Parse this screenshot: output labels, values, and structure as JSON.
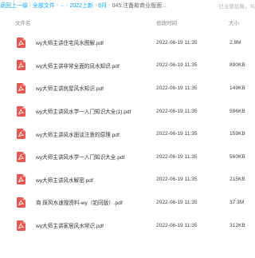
{
  "breadcrumb": {
    "back": "返回上一级",
    "items": [
      "全部文件",
      "...",
      "2022上新",
      "6月",
      "045.注备款商业版面..."
    ],
    "loaded_status": "已全部加载，共"
  },
  "columns": {
    "name": "文件名",
    "time": "修改时间",
    "size": "大小"
  },
  "files": [
    {
      "name": "wy大师主讲住宅风水图解.pdf",
      "time": "2022-06-19 11:35",
      "size": "2.8M"
    },
    {
      "name": "wy大师主讲非常全面的风水知识.pdf",
      "time": "2022-06-19 11:35",
      "size": "890KB"
    },
    {
      "name": "wy大师主讲房屋风水知识.pdf",
      "time": "2022-06-19 11:35",
      "size": "149KB"
    },
    {
      "name": "wy大师主讲风水学一入门知识大全(1).pdf",
      "time": "2022-06-19 11:35",
      "size": "596KB"
    },
    {
      "name": "wy大师主讲风水面谈注意的原理.pdf",
      "time": "2022-06-19 11:35",
      "size": "159KB"
    },
    {
      "name": "wy大师主讲风水学一入门知识大全.pdf",
      "time": "2022-06-19 11:35",
      "size": "560KB"
    },
    {
      "name": "wy大师主讲风水解密.pdf",
      "time": "2022-06-19 11:35",
      "size": "215KB"
    },
    {
      "name": "商 踩风水速搜资料-wy（铂同版）.pdf",
      "time": "2022-06-19 11:35",
      "size": "37.3M"
    },
    {
      "name": "wy大师主讲家居风水常识.pdf",
      "time": "2022-06-19 11:35",
      "size": "312KB"
    }
  ],
  "colors": {
    "accent": "#06a7ff",
    "pdf_icon": "#e9564f"
  },
  "icons": {
    "file": "pdf-file-icon"
  }
}
